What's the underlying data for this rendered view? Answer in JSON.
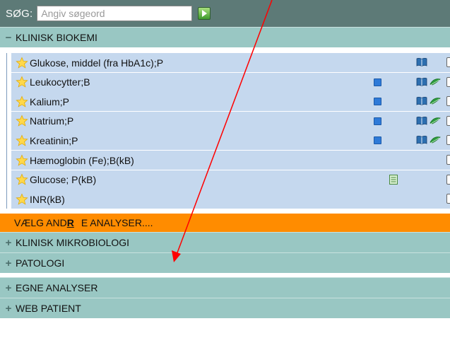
{
  "search": {
    "label": "SØG:",
    "placeholder": "Angiv søgeord"
  },
  "sections": [
    {
      "toggle": "−",
      "title": "KLINISK BIOKEMI"
    },
    {
      "toggle": "+",
      "title": "KLINISK MIKROBIOLOGI"
    },
    {
      "toggle": "+",
      "title": "PATOLOGI"
    },
    {
      "toggle": "+",
      "title": "EGNE ANALYSER"
    },
    {
      "toggle": "+",
      "title": "WEB PATIENT"
    }
  ],
  "analyses": [
    {
      "name": "Glukose, middel (fra HbA1c);P",
      "icons": [
        "book-icon"
      ]
    },
    {
      "name": "Leukocytter;B",
      "icons": [
        "blue-square-icon",
        "book-icon",
        "green-leaf-icon"
      ]
    },
    {
      "name": "Kalium;P",
      "icons": [
        "blue-square-icon",
        "book-icon",
        "green-leaf-icon"
      ]
    },
    {
      "name": "Natrium;P",
      "icons": [
        "blue-square-icon",
        "book-icon",
        "green-leaf-icon"
      ]
    },
    {
      "name": "Kreatinin;P",
      "icons": [
        "blue-square-icon",
        "book-icon",
        "green-leaf-icon"
      ]
    },
    {
      "name": "Hæmoglobin (Fe);B(kB)",
      "icons": []
    },
    {
      "name": "Glucose; P(kB)",
      "icons": [
        "document-icon"
      ]
    },
    {
      "name": "INR(kB)",
      "icons": []
    }
  ],
  "choose_more": {
    "prefix": "VÆLG AND",
    "accent": "R",
    "suffix": "E ANALYSER...."
  },
  "colors": {
    "search_bar": "#5d7a77",
    "section_header": "#99c7c3",
    "row_background": "#c5d8ee",
    "choose_more_bar": "#ff8c00",
    "annotation_arrow": "#ff0000"
  }
}
